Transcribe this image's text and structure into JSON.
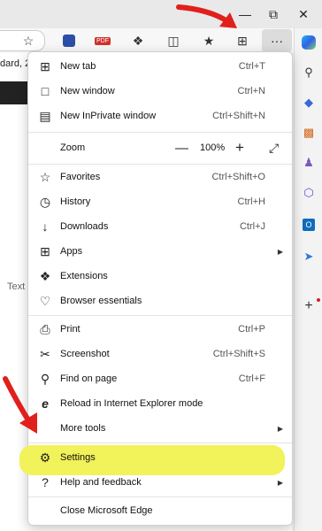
{
  "page": {
    "left_text": "dard, 2",
    "text_label": "Text"
  },
  "menu": {
    "items": [
      {
        "label": "New tab",
        "shortcut": "Ctrl+T",
        "icon": "new-tab-icon"
      },
      {
        "label": "New window",
        "shortcut": "Ctrl+N",
        "icon": "new-window-icon"
      },
      {
        "label": "New InPrivate window",
        "shortcut": "Ctrl+Shift+N",
        "icon": "inprivate-icon"
      },
      {
        "label": "Favorites",
        "shortcut": "Ctrl+Shift+O",
        "icon": "favorites-icon"
      },
      {
        "label": "History",
        "shortcut": "Ctrl+H",
        "icon": "history-icon"
      },
      {
        "label": "Downloads",
        "shortcut": "Ctrl+J",
        "icon": "downloads-icon"
      },
      {
        "label": "Apps",
        "shortcut": "",
        "icon": "apps-icon"
      },
      {
        "label": "Extensions",
        "shortcut": "",
        "icon": "extensions-icon"
      },
      {
        "label": "Browser essentials",
        "shortcut": "",
        "icon": "browser-essentials-icon"
      },
      {
        "label": "Print",
        "shortcut": "Ctrl+P",
        "icon": "print-icon"
      },
      {
        "label": "Screenshot",
        "shortcut": "Ctrl+Shift+S",
        "icon": "screenshot-icon"
      },
      {
        "label": "Find on page",
        "shortcut": "Ctrl+F",
        "icon": "find-icon"
      },
      {
        "label": "Reload in Internet Explorer mode",
        "shortcut": "",
        "icon": "ie-mode-icon"
      },
      {
        "label": "More tools",
        "shortcut": "",
        "icon": "more-tools-icon"
      },
      {
        "label": "Settings",
        "shortcut": "",
        "icon": "settings-icon"
      },
      {
        "label": "Help and feedback",
        "shortcut": "",
        "icon": "help-icon"
      },
      {
        "label": "Close Microsoft Edge",
        "shortcut": "",
        "icon": ""
      }
    ],
    "zoom": {
      "label": "Zoom",
      "value": "100%",
      "minus": "—",
      "plus": "+"
    }
  },
  "colors": {
    "highlight": "#f2f25a",
    "annotation_arrow": "#e0201c"
  }
}
